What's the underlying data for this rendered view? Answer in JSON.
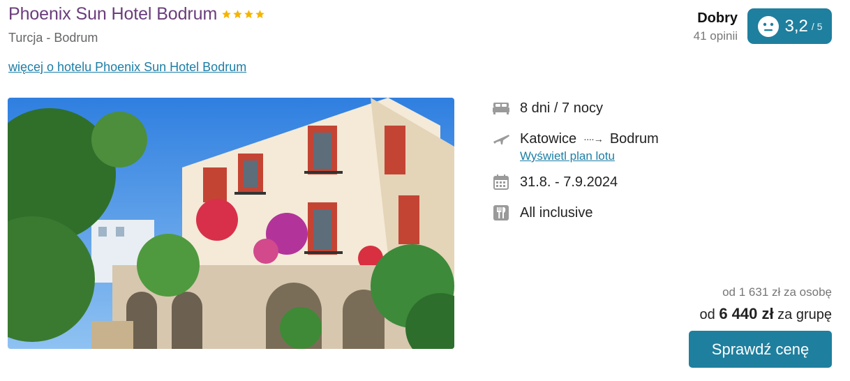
{
  "hotel": {
    "name": "Phoenix Sun Hotel Bodrum",
    "stars": 4,
    "location": "Turcja - Bodrum",
    "more_link": "więcej o hotelu Phoenix Sun Hotel Bodrum"
  },
  "rating": {
    "word": "Dobry",
    "reviews": "41 opinii",
    "value": "3,2",
    "max": "/ 5",
    "face_icon": "neutral-face-icon"
  },
  "details": {
    "duration": "8 dni / 7 nocy",
    "from": "Katowice",
    "to": "Bodrum",
    "flight_plan_link": "Wyświetl plan lotu",
    "dates": "31.8. - 7.9.2024",
    "board": "All inclusive"
  },
  "price": {
    "per_person": "od 1 631 zł za osobę",
    "group_prefix": "od",
    "group_amount": "6 440 zł",
    "group_suffix": "za grupę",
    "button_label": "Sprawdź cenę"
  },
  "colors": {
    "title": "#6a3d7c",
    "accent": "#1f7f9e",
    "link": "#1c7ea6",
    "star": "#f5b400"
  }
}
